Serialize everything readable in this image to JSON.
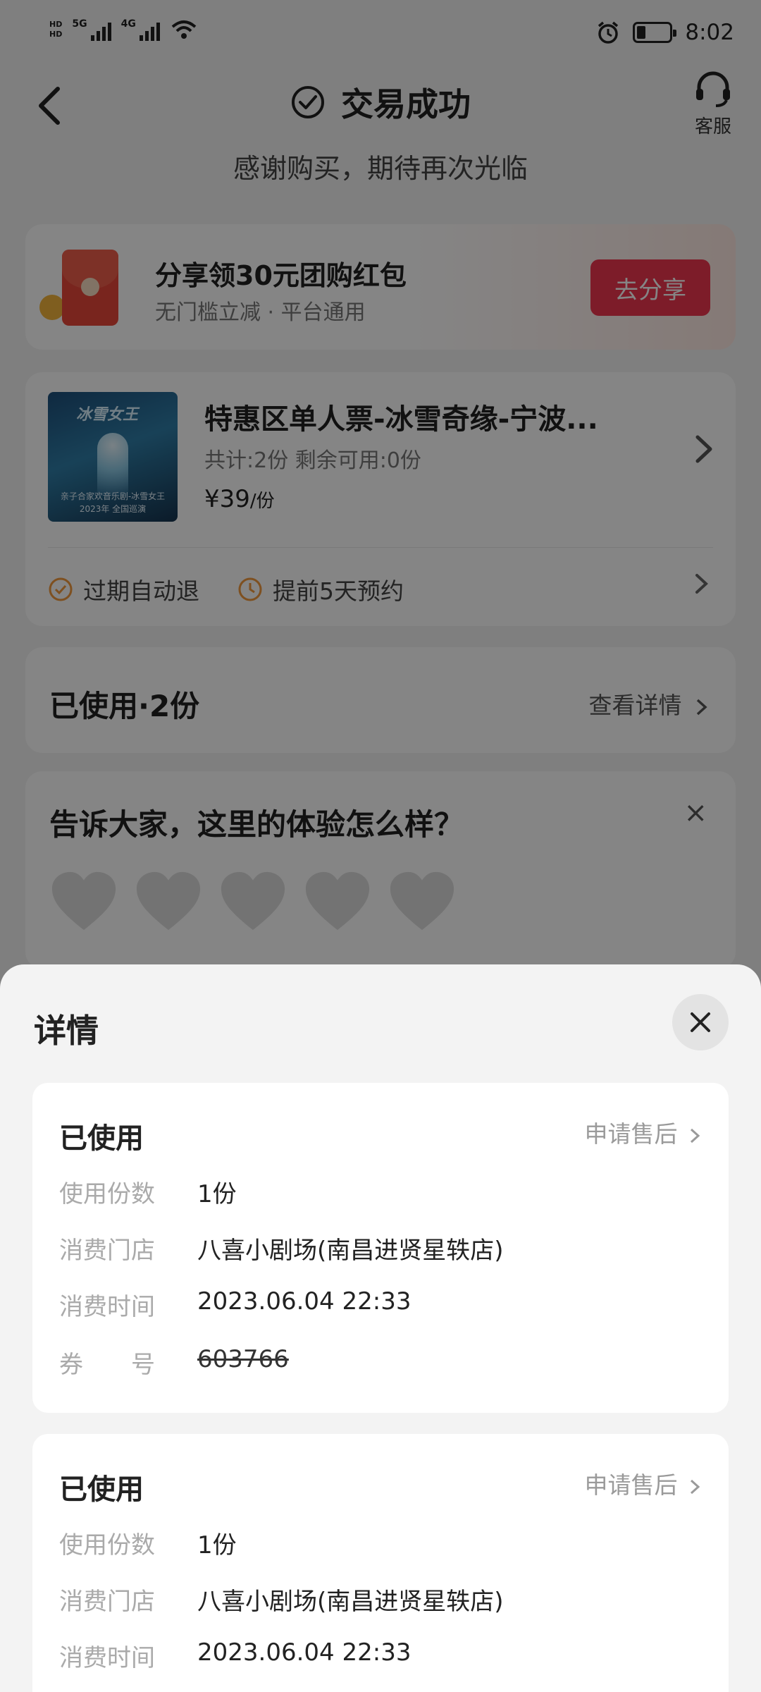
{
  "status_bar": {
    "net1": "HD",
    "net2": "HD",
    "sig1_label": "5G",
    "sig2_label": "4G",
    "time": "8:02"
  },
  "header": {
    "title": "交易成功",
    "customer_service": "客服",
    "subtitle": "感谢购买，期待再次光临"
  },
  "share": {
    "title": "分享领30元团购红包",
    "subtitle": "无门槛立减 · 平台通用",
    "button": "去分享"
  },
  "product": {
    "poster_title": "冰雪女王",
    "poster_line1": "亲子合家欢音乐剧-冰雪女王",
    "poster_line2": "2023年 全国巡演",
    "name": "特惠区单人票-冰雪奇缘-宁波...",
    "count": "共计:2份  剩余可用:0份",
    "price": "¥39",
    "price_unit": "/份",
    "tag1": "过期自动退",
    "tag2": "提前5天预约"
  },
  "used": {
    "title": "已使用·2份",
    "link": "查看详情"
  },
  "review": {
    "question": "告诉大家，这里的体验怎么样？",
    "close": "×"
  },
  "sheet": {
    "title": "详情",
    "records": [
      {
        "status": "已使用",
        "after_sale": "申请售后",
        "qty_label": "使用份数",
        "qty": "1份",
        "store_label": "消费门店",
        "store": "八喜小剧场(南昌进贤星轶店)",
        "time_label": "消费时间",
        "time": "2023.06.04 22:33",
        "code_label": "券　　号",
        "code": "603766"
      },
      {
        "status": "已使用",
        "after_sale": "申请售后",
        "qty_label": "使用份数",
        "qty": "1份",
        "store_label": "消费门店",
        "store": "八喜小剧场(南昌进贤星轶店)",
        "time_label": "消费时间",
        "time": "2023.06.04 22:33"
      }
    ]
  },
  "colors": {
    "accent_red": "#f0364f",
    "tag_orange": "#f19a3e",
    "overlay": "rgba(0,0,0,0.48)"
  },
  "icons": [
    "back-icon",
    "check-circle-icon",
    "headset-icon",
    "red-packet-icon",
    "chevron-right-icon",
    "check-circle-outline-icon",
    "clock-icon",
    "heart-icon",
    "close-icon"
  ]
}
